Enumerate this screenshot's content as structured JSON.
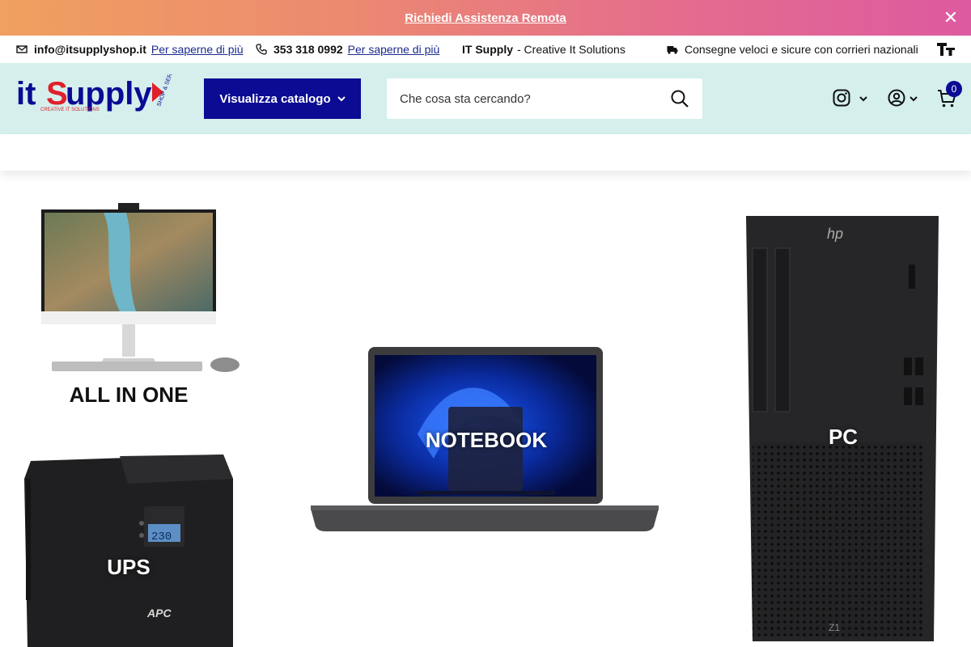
{
  "announcement": {
    "link_text": "Richiedi Assistenza Remota"
  },
  "infobar": {
    "email": "info@itsupplyshop.it",
    "email_link": "Per saperne di più",
    "phone": "353 318 0992",
    "phone_link": "Per saperne di più",
    "brand": "IT Supply",
    "brand_tagline": "- Creative It Solutions",
    "shipping": "Consegne veloci e sicure con corrieri nazionali"
  },
  "header": {
    "logo_main": "it Supply",
    "logo_sub": "CREATIVE IT SOLUTIONS",
    "logo_badge": "SHOP & SERVICE",
    "catalog_button": "Visualizza catalogo",
    "search_placeholder": "Che cosa sta cercando?",
    "cart_count": "0"
  },
  "categories": [
    {
      "label": "ALL IN ONE"
    },
    {
      "label": "NOTEBOOK"
    },
    {
      "label": "PC"
    },
    {
      "label": "UPS"
    }
  ],
  "colors": {
    "brand_blue": "#0b0b94",
    "header_bg": "#d4efec",
    "logo_red": "#e0202a"
  }
}
